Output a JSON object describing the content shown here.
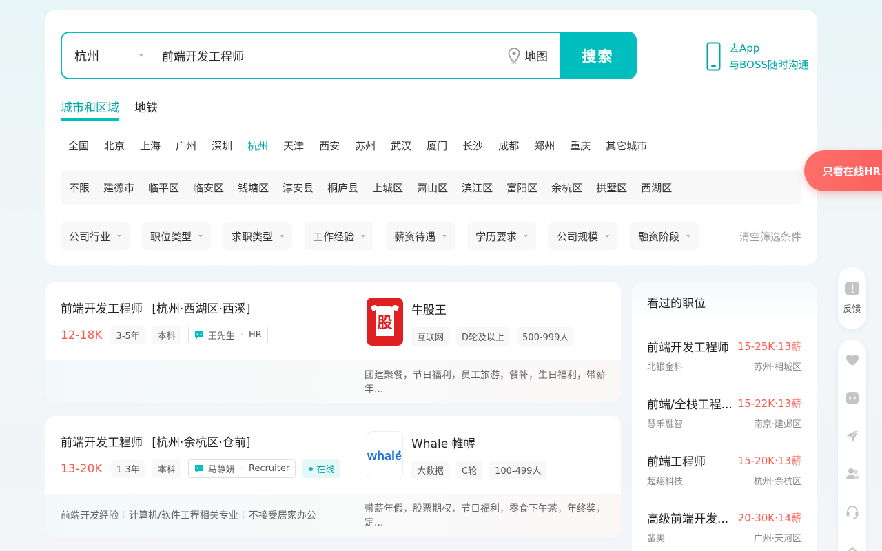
{
  "search": {
    "city": "杭州",
    "query": "前端开发工程师",
    "map_label": "地图",
    "button_label": "搜索"
  },
  "app_promo": {
    "line1": "去App",
    "line2": "与BOSS随时沟通"
  },
  "tabs": [
    {
      "label": "城市和区域",
      "active": true
    },
    {
      "label": "地铁",
      "active": false
    }
  ],
  "cities": [
    "全国",
    "北京",
    "上海",
    "广州",
    "深圳",
    "杭州",
    "天津",
    "西安",
    "苏州",
    "武汉",
    "厦门",
    "长沙",
    "成都",
    "郑州",
    "重庆",
    "其它城市"
  ],
  "active_city": "杭州",
  "districts": [
    "不限",
    "建德市",
    "临平区",
    "临安区",
    "钱塘区",
    "淳安县",
    "桐庐县",
    "上城区",
    "萧山区",
    "滨江区",
    "富阳区",
    "余杭区",
    "拱墅区",
    "西湖区"
  ],
  "filters": [
    "公司行业",
    "职位类型",
    "求职类型",
    "工作经验",
    "薪资待遇",
    "学历要求",
    "公司规模",
    "融资阶段"
  ],
  "clear_filters": "清空筛选条件",
  "online_hr_button": "只看在线HR",
  "jobs": [
    {
      "title": "前端开发工程师",
      "location": "[杭州·西湖区·西溪]",
      "salary": "12-18K",
      "experience": "3-5年",
      "education": "本科",
      "hr_name": "王先生",
      "hr_role": "HR",
      "online": "",
      "company": "牛股王",
      "company_tags": [
        "互联网",
        "D轮及以上",
        "500-999人"
      ],
      "skills": [],
      "welfare": "团建聚餐，节日福利，员工旅游，餐补，生日福利，带薪年..."
    },
    {
      "title": "前端开发工程师",
      "location": "[杭州·余杭区·仓前]",
      "salary": "13-20K",
      "experience": "1-3年",
      "education": "本科",
      "hr_name": "马静妍",
      "hr_role": "Recruiter",
      "online": "在线",
      "company": "Whale 帷幄",
      "company_tags": [
        "大数据",
        "C轮",
        "100-499人"
      ],
      "skills": [
        "前端开发经验",
        "计算机/软件工程相关专业",
        "不接受居家办公"
      ],
      "welfare": "带薪年假，股票期权，节日福利，零食下午茶，年终奖，定..."
    }
  ],
  "logos": {
    "logo1_text": "股",
    "logo2_text": "whale"
  },
  "viewed": {
    "title": "看过的职位",
    "items": [
      {
        "title": "前端开发工程师",
        "salary": "15-25K·13薪",
        "company": "北银金科",
        "location": "苏州·相城区"
      },
      {
        "title": "前端/全栈工程...",
        "salary": "15-22K·13薪",
        "company": "慧禾融智",
        "location": "南京·建邺区"
      },
      {
        "title": "前端工程师",
        "salary": "15-20K·13薪",
        "company": "超翔科技",
        "location": "杭州·余杭区"
      },
      {
        "title": "高级前端开发...",
        "salary": "20-30K·14薪",
        "company": "蜚美",
        "location": "广州·天河区"
      }
    ]
  },
  "side": {
    "feedback_label": "反馈"
  },
  "colors": {
    "accent": "#00bebd",
    "accent_text": "#00a6a7",
    "salary": "#fe574a",
    "hr_button": "#fb5f5d"
  }
}
